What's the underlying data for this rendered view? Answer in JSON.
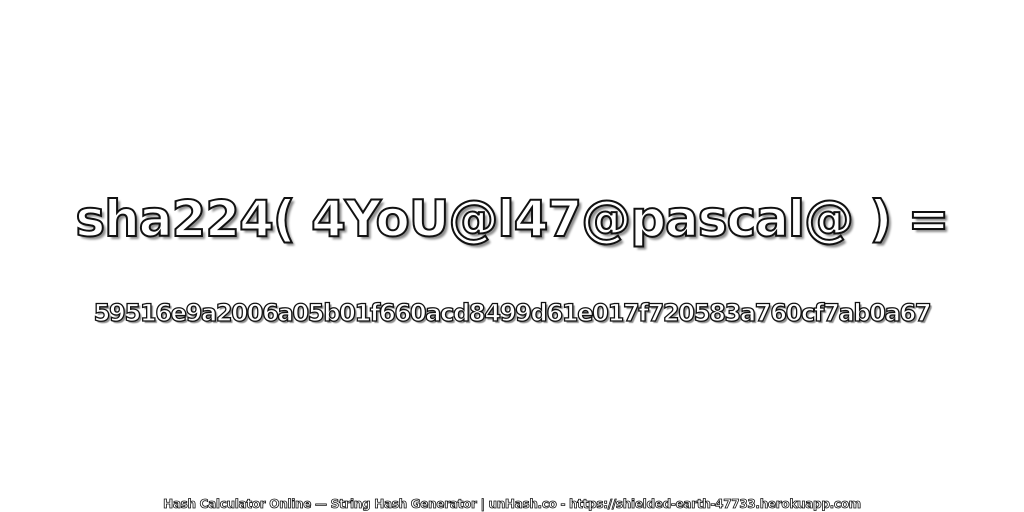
{
  "main": {
    "expression": "sha224( 4YoU@l47@pascal@ ) =",
    "hash": "59516e9a2006a05b01f660acd8499d61e017f720583a760cf7ab0a67"
  },
  "footer": {
    "text": "Hash Calculator Online — String Hash Generator | unHash.co - https://shielded-earth-47733.herokuapp.com"
  },
  "colors": {
    "background": "#ffffff",
    "text_fill": "#ffffff",
    "text_outline": "#111111"
  }
}
